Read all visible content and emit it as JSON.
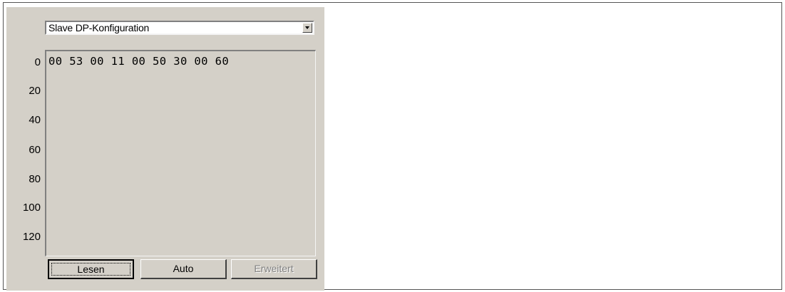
{
  "selector": {
    "selected_value": "Slave DP-Konfiguration"
  },
  "data_view": {
    "row_offsets": [
      "0",
      "20",
      "40",
      "60",
      "80",
      "100",
      "120"
    ],
    "bytes": [
      "00",
      "53",
      "00",
      "11",
      "00",
      "50",
      "30",
      "00",
      "60"
    ]
  },
  "buttons": {
    "read_label": "Lesen",
    "auto_label": "Auto",
    "extended_label": "Erweitert"
  }
}
